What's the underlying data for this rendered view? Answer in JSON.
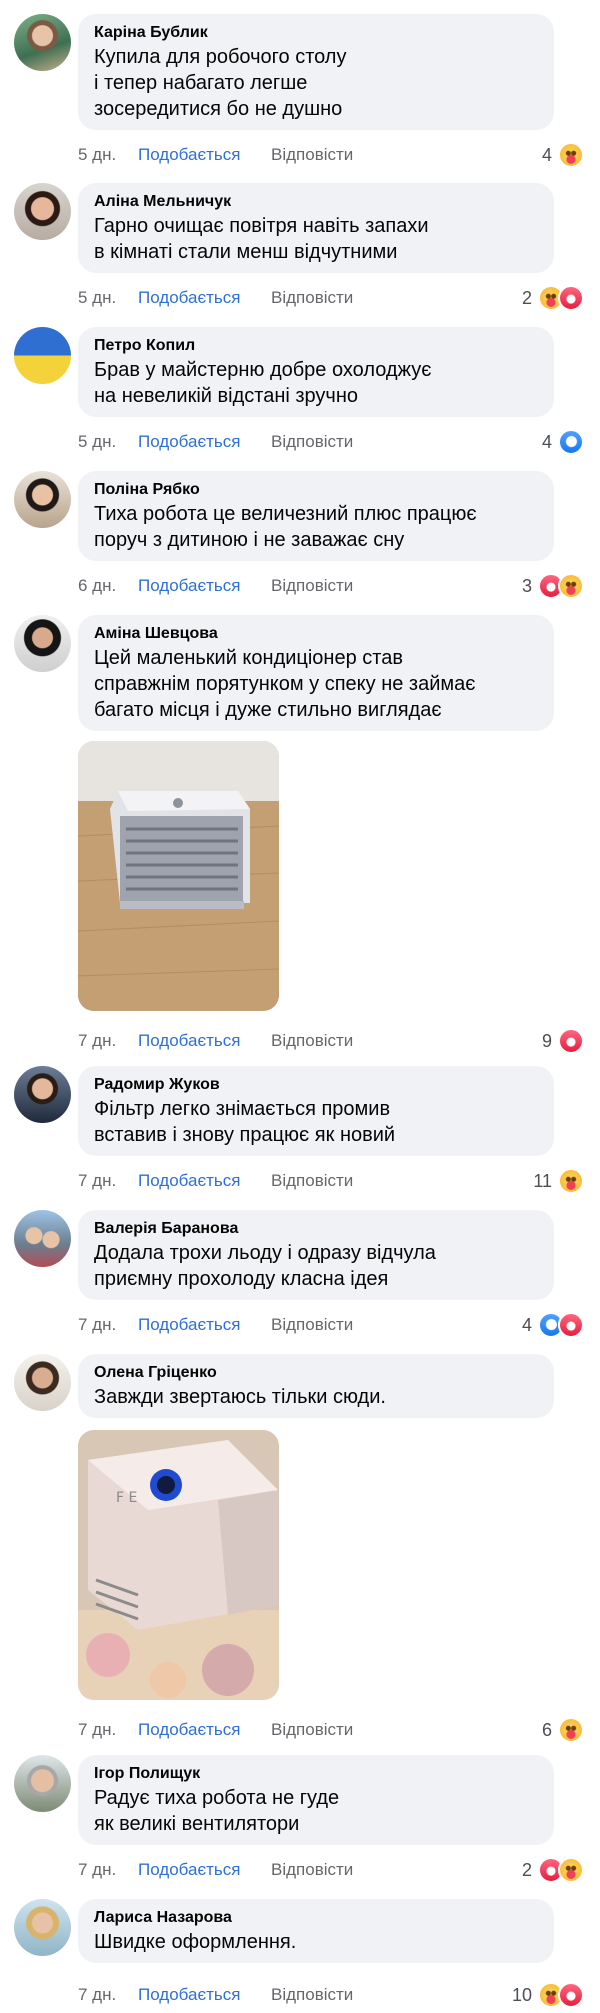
{
  "labels": {
    "like": "Подобається",
    "reply": "Відповісти"
  },
  "colors": {
    "link": "#2e6fd8",
    "muted": "#65676b",
    "bubble": "#f0f2f5"
  },
  "comments": [
    {
      "author": "Каріна Бублик",
      "text": "Купила для робочого столу\nі тепер набагато легше\nзосередитися бо не душно",
      "time": "5 дн.",
      "count": "4",
      "reactions": [
        "care"
      ],
      "avatar": "photo"
    },
    {
      "author": "Аліна Мельничук",
      "text": "Гарно очищає повітря навіть запахи\nв кімнаті стали менш відчутними",
      "time": "5 дн.",
      "count": "2",
      "reactions": [
        "care",
        "love"
      ],
      "avatar": "photo"
    },
    {
      "author": "Петро Копил",
      "text": "Брав у майстерню добре охолоджує\nна невеликій відстані зручно",
      "time": "5 дн.",
      "count": "4",
      "reactions": [
        "like"
      ],
      "avatar": "flag"
    },
    {
      "author": "Поліна Рябко",
      "text": "Тиха робота це величезний плюс працює\nпоруч з дитиною і не заважає сну",
      "time": "6 дн.",
      "count": "3",
      "reactions": [
        "love",
        "care"
      ],
      "avatar": "photo"
    },
    {
      "author": "Аміна Шевцова",
      "text": "Цей маленький кондиціонер став\nсправжнім порятунком у спеку не займає\nбагато місця і дуже стильно виглядає",
      "time": "7 дн.",
      "count": "9",
      "reactions": [
        "love"
      ],
      "avatar": "photo",
      "photo": "cooler-grey"
    },
    {
      "author": "Радомир Жуков",
      "text": "Фільтр легко знімається промив\nвставив і знову працює як новий",
      "time": "7 дн.",
      "count": "11",
      "reactions": [
        "care"
      ],
      "avatar": "photo"
    },
    {
      "author": "Валерія Баранова",
      "text": "Додала трохи льоду і одразу відчула\nприємну прохолоду класна ідея",
      "time": "7 дн.",
      "count": "4",
      "reactions": [
        "like",
        "love"
      ],
      "avatar": "photo"
    },
    {
      "author": "Олена Гріценко",
      "text": "Завжди звертаюсь тільки сюди.",
      "time": "7 дн.",
      "count": "6",
      "reactions": [
        "care"
      ],
      "avatar": "photo",
      "photo": "cooler-pink"
    },
    {
      "author": "Ігор Полищук",
      "text": "Радує тиха робота не гуде\nяк великі вентилятори",
      "time": "7 дн.",
      "count": "2",
      "reactions": [
        "love",
        "care"
      ],
      "avatar": "photo"
    },
    {
      "author": "Лариса Назарова",
      "text": "Швидке оформлення.",
      "time": "7 дн.",
      "count": "10",
      "reactions": [
        "care",
        "love"
      ],
      "avatar": "photo"
    }
  ]
}
